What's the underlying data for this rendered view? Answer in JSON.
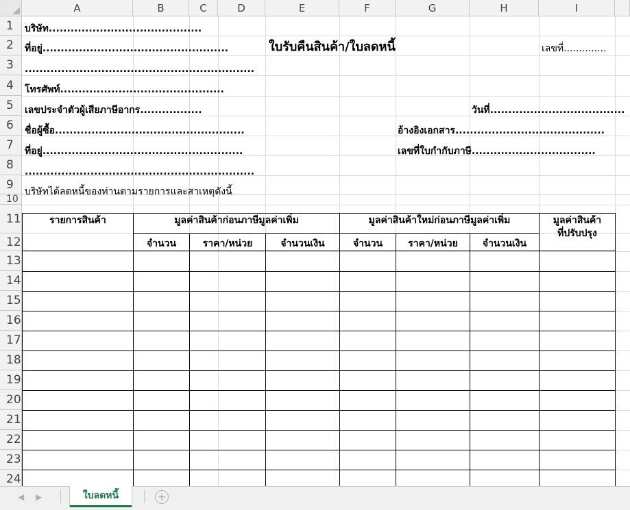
{
  "columns": [
    "A",
    "B",
    "C",
    "D",
    "E",
    "F",
    "G",
    "H",
    "I"
  ],
  "rows": [
    "1",
    "2",
    "3",
    "4",
    "5",
    "6",
    "7",
    "8",
    "9",
    "10",
    "11",
    "12",
    "13",
    "14",
    "15",
    "16",
    "17",
    "18",
    "19",
    "20",
    "21",
    "22",
    "23",
    "24"
  ],
  "form": {
    "company": "บริษัท..........................................",
    "address1": "ที่อยู่...................................................",
    "title": "ใบรับคืนสินค้า/ใบลดหนี้",
    "doc_no": "เลขที่..............",
    "address_line2": "...............................................................",
    "phone": "โทรศัพท์.............................................",
    "tax_id": "เลขประจำตัวผู้เสียภาษีอากร.................",
    "date": "วันที่.....................................",
    "buyer": "ชื่อผู้ซื้อ....................................................",
    "reference": "อ้างอิงเอกสาร.........................................",
    "buyer_address": "ที่อยู่.......................................................",
    "invoice_no": "เลขที่ใบกำกับภาษี..................................",
    "buyer_address_line2": "...............................................................",
    "statement": "บริษัทได้ลดหนี้ของท่านตามรายการและสาเหตุดังนี้"
  },
  "table": {
    "col_item": "รายการสินค้า",
    "group_before": "มูลค่าสินค้าก่อนภาษีมูลค่าเพิ่ม",
    "group_new": "มูลค่าสินค้าใหม่ก่อนภาษีมูลค่าเพิ่ม",
    "col_adjusted_1": "มูลค่าสินค้า",
    "col_adjusted_2": "ที่ปรับปรุง",
    "qty": "จำนวน",
    "unit_price": "ราคา/หน่วย",
    "amount": "จำนวนเงิน"
  },
  "sheet_tab": "ใบลดหนี้",
  "add_sheet": "+",
  "nav": {
    "prev": "◀",
    "next": "▶"
  }
}
